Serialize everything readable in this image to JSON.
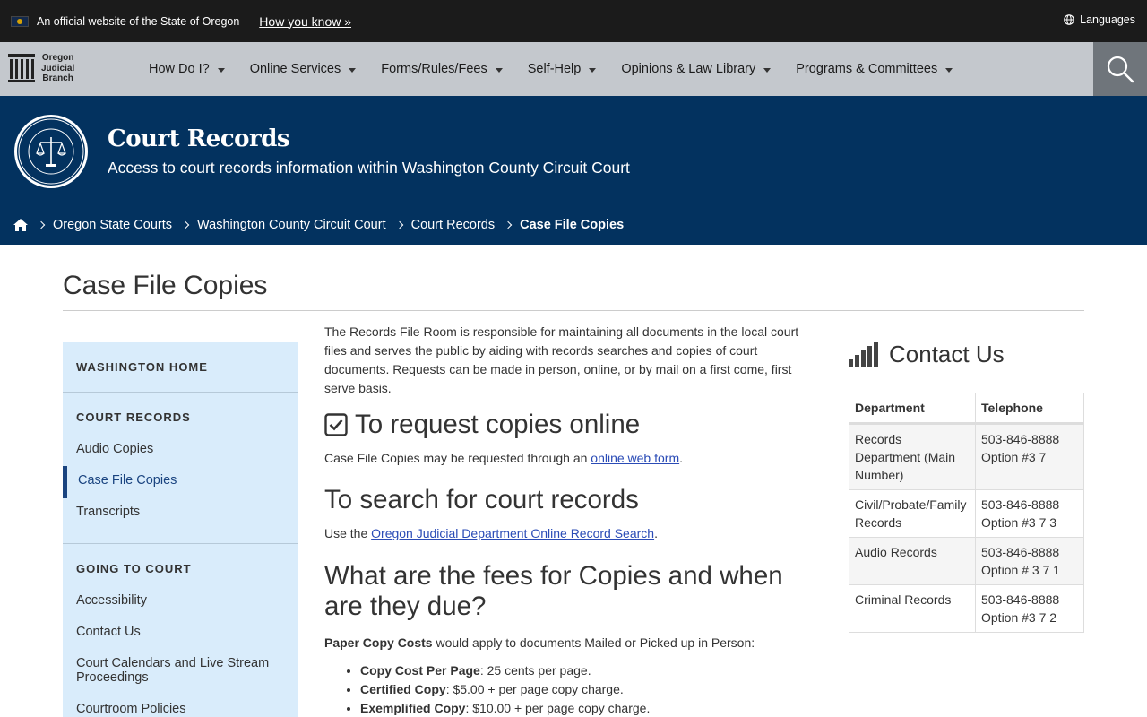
{
  "banner": {
    "official_text": "An official website of the State of Oregon",
    "how_you_know": "How you know »",
    "languages": "Languages"
  },
  "logo": {
    "line1": "Oregon",
    "line2": "Judicial",
    "line3": "Branch"
  },
  "nav": {
    "items": [
      "How Do I?",
      "Online Services",
      "Forms/Rules/Fees",
      "Self-Help",
      "Opinions & Law Library",
      "Programs & Committees"
    ]
  },
  "hero": {
    "title": "Court Records",
    "subtitle": "Access to court records information within Washington County Circuit Court"
  },
  "breadcrumb": {
    "items": [
      "Oregon State Courts",
      "Washington County Circuit Court",
      "Court Records"
    ],
    "current": "Case File Copies"
  },
  "page_title": "Case File Copies",
  "sidebar": {
    "home": "WASHINGTON HOME",
    "court_records_head": "COURT RECORDS",
    "court_records_items": [
      "Audio Copies",
      "Case File Copies",
      "Transcripts"
    ],
    "going_head": "GOING TO COURT",
    "going_items": [
      "Accessibility",
      "Contact Us",
      "Court Calendars and Live Stream Proceedings",
      "Courtroom Policies"
    ]
  },
  "content": {
    "intro": "The Records File Room is responsible for maintaining all documents in the local court files and serves the public by aiding with records searches and copies of court documents. Requests can be made in person, online, or by mail on a first come, first serve basis.",
    "h_online": "To request copies online",
    "p_online_pre": "Case File Copies may be requested through an ",
    "p_online_link": "online web form",
    "p_online_post": ".",
    "h_search": "To search for court records",
    "p_search_pre": "Use the ",
    "p_search_link": "Oregon Judicial Department Online Record Search",
    "p_search_post": ".",
    "h_fees": "What are the fees for Copies and when are they due?",
    "paper_bold": "Paper Copy Costs",
    "paper_rest": " would apply to documents Mailed or Picked up in Person:",
    "fees": [
      {
        "label": "Copy Cost Per Page",
        "text": ": 25 cents per page."
      },
      {
        "label": "Certified Copy",
        "text": ": $5.00 + per page copy charge."
      },
      {
        "label": "Exemplified Copy",
        "text": ": $10.00 + per page copy charge."
      }
    ]
  },
  "contact": {
    "title": "Contact Us",
    "headers": [
      "Department",
      "Telephone"
    ],
    "rows": [
      {
        "dept": "Records Department (Main Number)",
        "phone1": "503-846-8888",
        "phone2": "Option #3 7"
      },
      {
        "dept": "Civil/Probate/Family Records",
        "phone1": "503-846-8888",
        "phone2": "Option #3 7 3"
      },
      {
        "dept": "Audio Records",
        "phone1": "503-846-8888",
        "phone2": "Option # 3 7 1"
      },
      {
        "dept": "Criminal Records",
        "phone1": "503-846-8888",
        "phone2": "Option #3 7 2"
      }
    ]
  },
  "colors": {
    "hero_bg": "#03325f",
    "nav_bg": "#c4c8cd",
    "sidebar_bg": "#d9ecfb",
    "link": "#2a4bb6"
  }
}
